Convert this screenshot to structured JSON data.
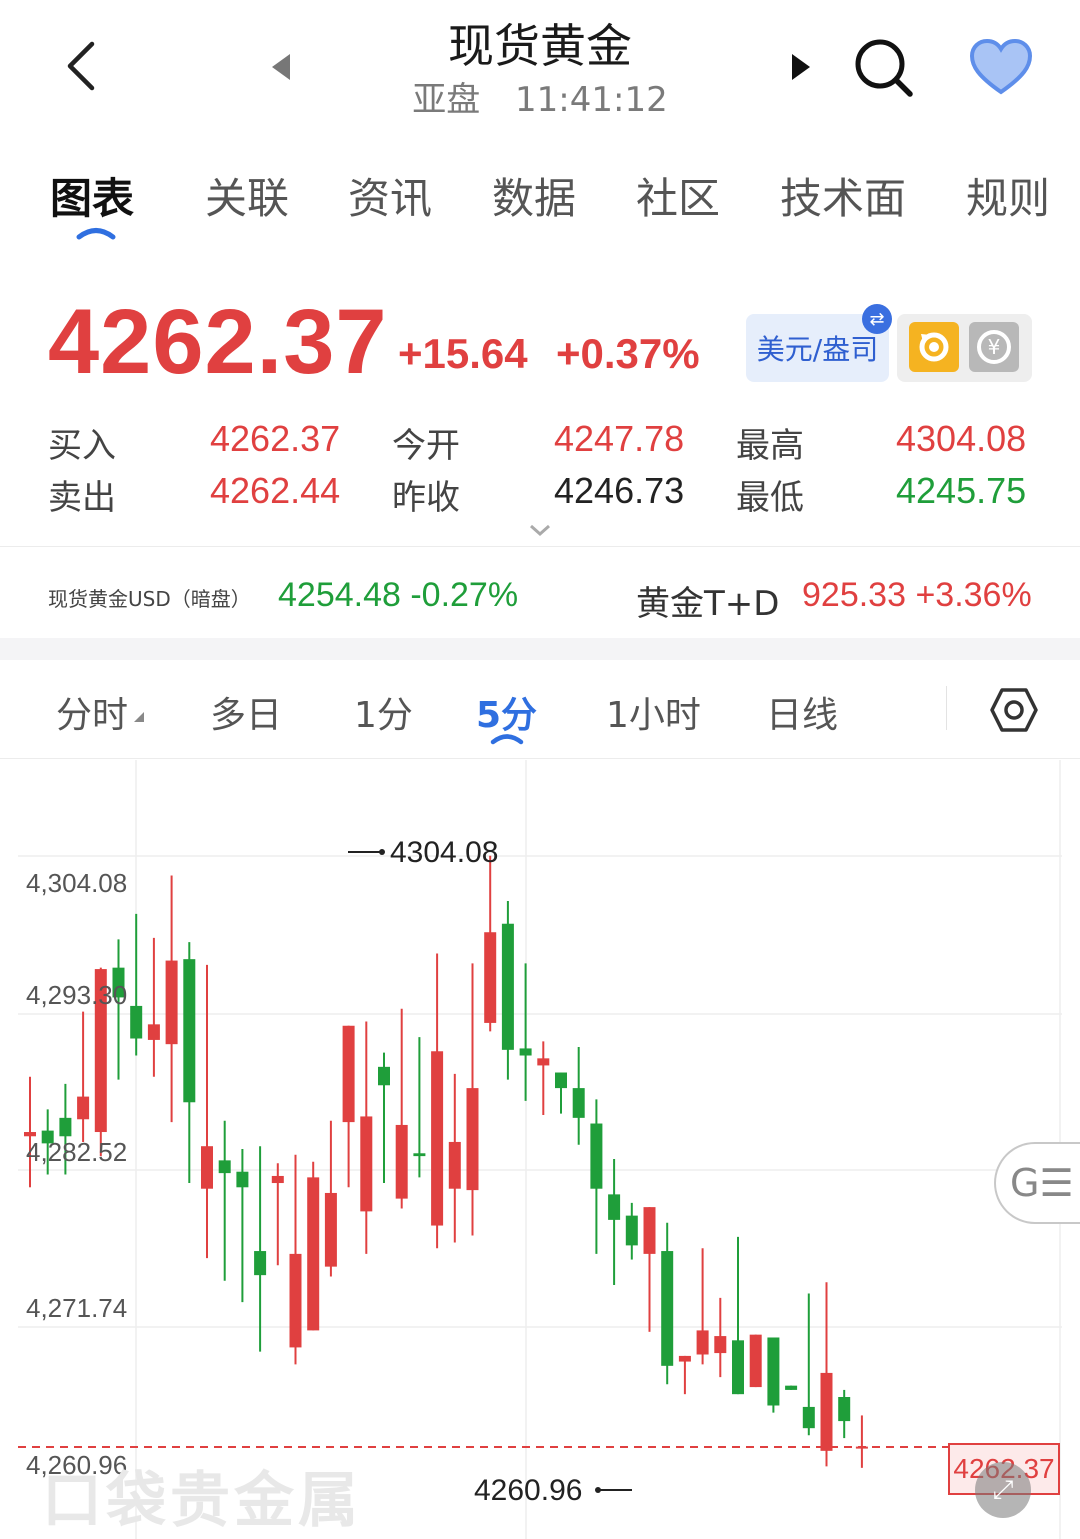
{
  "header": {
    "title": "现货黄金",
    "session": "亚盘",
    "time": "11:41:12"
  },
  "tabs": [
    {
      "label": "图表",
      "active": true
    },
    {
      "label": "关联"
    },
    {
      "label": "资讯"
    },
    {
      "label": "数据"
    },
    {
      "label": "社区"
    },
    {
      "label": "技术面"
    },
    {
      "label": "规则"
    }
  ],
  "quote": {
    "price": "4262.37",
    "change": "+15.64",
    "change_pct": "+0.37%",
    "unit_button": "美元/盎司",
    "rows": [
      {
        "label": "买入",
        "value": "4262.37"
      },
      {
        "label": "今开",
        "value": "4247.78"
      },
      {
        "label": "最高",
        "value": "4304.08"
      },
      {
        "label": "卖出",
        "value": "4262.44"
      },
      {
        "label": "昨收",
        "value": "4246.73"
      },
      {
        "label": "最低",
        "value": "4245.75"
      }
    ]
  },
  "related": {
    "left_label": "现货黄金USD（暗盘）",
    "left_value": "4254.48 -0.27%",
    "right_label": "黄金T+D",
    "right_value": "925.33 +3.36%"
  },
  "periods": [
    {
      "label": "分时"
    },
    {
      "label": "多日"
    },
    {
      "label": "1分"
    },
    {
      "label": "5分",
      "active": true
    },
    {
      "label": "1小时"
    },
    {
      "label": "日线"
    }
  ],
  "chart_data": {
    "type": "candlestick",
    "y_ticks": [
      "4,304.08",
      "4,293.30",
      "4,282.52",
      "4,271.74",
      "4,260.96"
    ],
    "ylim": [
      4257.5,
      4310.2
    ],
    "high_marker": "4304.08",
    "low_marker": "4260.96",
    "last_price_tag": "4262.37",
    "last_price": 4262.37,
    "watermark": "口袋贵金属",
    "candles": [
      [
        4284.3,
        4288.5,
        4280.7,
        4284.6
      ],
      [
        4284.7,
        4286.2,
        4281.6,
        4283.8
      ],
      [
        4285.6,
        4288.0,
        4281.6,
        4284.3
      ],
      [
        4285.5,
        4293.1,
        4283.9,
        4287.1
      ],
      [
        4284.6,
        4296.2,
        4282.9,
        4296.1
      ],
      [
        4296.2,
        4298.2,
        4288.3,
        4294.1
      ],
      [
        4293.5,
        4300.0,
        4290.0,
        4291.2
      ],
      [
        4291.1,
        4298.3,
        4288.5,
        4292.2
      ],
      [
        4290.8,
        4302.7,
        4285.3,
        4296.7
      ],
      [
        4296.8,
        4298.0,
        4281.0,
        4286.7
      ],
      [
        4280.6,
        4296.4,
        4275.7,
        4283.6
      ],
      [
        4282.6,
        4285.4,
        4274.1,
        4281.7
      ],
      [
        4281.8,
        4283.4,
        4272.6,
        4280.7
      ],
      [
        4276.2,
        4283.6,
        4269.1,
        4274.5
      ],
      [
        4281.0,
        4282.4,
        4275.2,
        4281.5
      ],
      [
        4269.4,
        4283.0,
        4268.2,
        4276.0
      ],
      [
        4270.6,
        4282.5,
        4270.8,
        4281.4
      ],
      [
        4275.1,
        4285.4,
        4274.4,
        4280.3
      ],
      [
        4285.3,
        4290.1,
        4280.7,
        4292.1
      ],
      [
        4279.0,
        4292.4,
        4276.0,
        4285.7
      ],
      [
        4289.2,
        4290.2,
        4281.0,
        4287.9
      ],
      [
        4279.9,
        4293.3,
        4279.2,
        4285.1
      ],
      [
        4283.1,
        4291.3,
        4281.4,
        4282.9
      ],
      [
        4278.0,
        4297.2,
        4276.4,
        4290.3
      ],
      [
        4280.6,
        4288.7,
        4276.8,
        4283.9
      ],
      [
        4280.5,
        4296.5,
        4277.3,
        4287.7
      ],
      [
        4292.3,
        4304.1,
        4291.7,
        4298.7
      ],
      [
        4299.3,
        4300.9,
        4288.3,
        4290.4
      ],
      [
        4290.5,
        4296.5,
        4286.8,
        4290.0
      ],
      [
        4289.3,
        4291.0,
        4285.8,
        4289.8
      ],
      [
        4288.8,
        4288.5,
        4285.9,
        4287.7
      ],
      [
        4287.7,
        4290.6,
        4283.7,
        4285.6
      ],
      [
        4285.2,
        4286.9,
        4276.0,
        4280.6
      ],
      [
        4280.2,
        4282.7,
        4273.8,
        4278.4
      ],
      [
        4278.7,
        4279.6,
        4275.6,
        4276.6
      ],
      [
        4276.0,
        4275.4,
        4270.5,
        4279.3
      ],
      [
        4276.2,
        4278.2,
        4266.8,
        4268.1
      ],
      [
        4268.4,
        4266.4,
        4266.1,
        4268.8
      ],
      [
        4268.9,
        4276.4,
        4268.2,
        4270.6
      ],
      [
        4269.0,
        4272.9,
        4267.3,
        4270.2
      ],
      [
        4269.9,
        4277.2,
        4266.8,
        4266.1
      ],
      [
        4266.6,
        4266.9,
        4269.4,
        4270.3
      ],
      [
        4270.1,
        4270.1,
        4264.8,
        4265.3
      ],
      [
        4266.7,
        4266.6,
        4266.6,
        4266.4
      ],
      [
        4265.2,
        4273.2,
        4263.2,
        4263.7
      ],
      [
        4262.1,
        4274.0,
        4261.0,
        4267.6
      ],
      [
        4265.9,
        4266.4,
        4263.0,
        4264.2
      ],
      [
        4262.3,
        4264.6,
        4260.9,
        4262.4
      ]
    ]
  }
}
